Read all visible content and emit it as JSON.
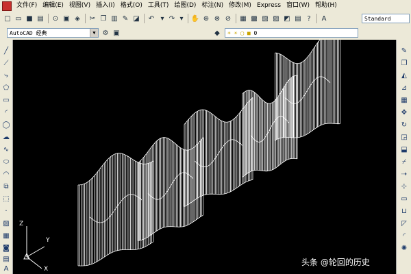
{
  "menu": {
    "items": [
      {
        "label": "文件(F)"
      },
      {
        "label": "编辑(E)"
      },
      {
        "label": "视图(V)"
      },
      {
        "label": "插入(I)"
      },
      {
        "label": "格式(O)"
      },
      {
        "label": "工具(T)"
      },
      {
        "label": "绘图(D)"
      },
      {
        "label": "标注(N)"
      },
      {
        "label": "修改(M)"
      },
      {
        "label": "Express"
      },
      {
        "label": "窗口(W)"
      },
      {
        "label": "帮助(H)"
      }
    ]
  },
  "toolbar": {
    "text_style": "Standard",
    "workspace": "AutoCAD 经典",
    "layer": "0"
  },
  "ucs": {
    "x": "X",
    "y": "Y",
    "z": "Z"
  },
  "watermark": "头条 @轮回的历史",
  "colors": {
    "canvas": "#000000",
    "wireframe": "#ffffff",
    "toolbar": "#ece9d8"
  }
}
